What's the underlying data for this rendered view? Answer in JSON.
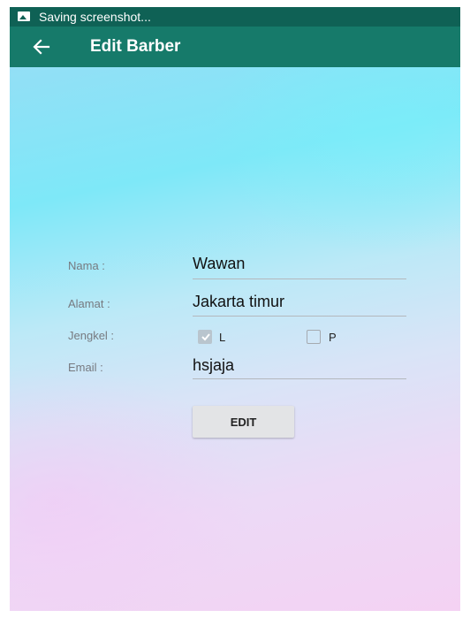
{
  "status_bar": {
    "icon": "image-icon",
    "text": "Saving screenshot..."
  },
  "app_bar": {
    "back_icon": "arrow-left-icon",
    "title": "Edit Barber",
    "color": "#167a6a"
  },
  "form": {
    "nama": {
      "label": "Nama :",
      "value": "Wawan"
    },
    "alamat": {
      "label": "Alamat :",
      "value": "Jakarta timur"
    },
    "jengkel": {
      "label": "Jengkel :",
      "options": [
        {
          "label": "L",
          "checked": true
        },
        {
          "label": "P",
          "checked": false
        }
      ]
    },
    "email": {
      "label": "Email :",
      "value": "hsjaja"
    }
  },
  "edit_button": {
    "label": "EDIT"
  }
}
